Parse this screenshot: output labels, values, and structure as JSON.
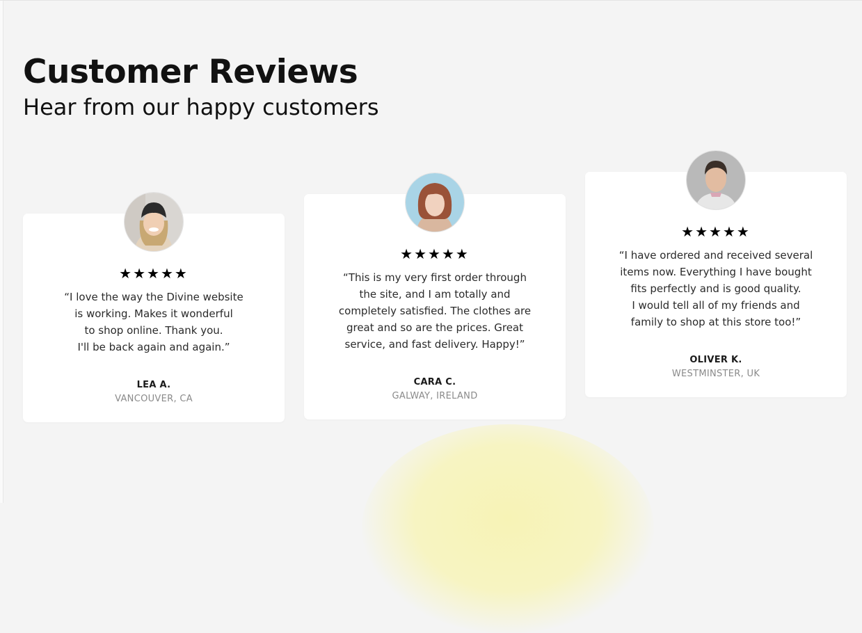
{
  "header": {
    "title": "Customer Reviews",
    "subtitle": "Hear from our happy customers"
  },
  "reviews": [
    {
      "stars": "★★★★★",
      "rating": 5,
      "quote": "“I love the way the Divine website\nis working. Makes it wonderful\nto shop online. Thank you.\nI'll be back again and again.”",
      "name": "LEA A.",
      "location": "VANCOUVER, CA"
    },
    {
      "stars": "★★★★★",
      "rating": 5,
      "quote": "“This is my very first order through\nthe site, and I am totally and\ncompletely satisfied. The clothes are\ngreat and so are the prices. Great\nservice, and fast delivery. Happy!”",
      "name": "CARA C.",
      "location": "GALWAY, IRELAND"
    },
    {
      "stars": "★★★★★",
      "rating": 5,
      "quote": "“I have ordered and received several\nitems now. Everything I have bought\nfits perfectly and is good quality.\nI would tell all of my friends and\nfamily to shop at this store too!”",
      "name": "OLIVER K.",
      "location": "WESTMINSTER, UK"
    }
  ],
  "colors": {
    "background": "#f4f4f4",
    "card": "#ffffff",
    "text": "#111111",
    "muted": "#8a8a8a",
    "accent_blob": "#f7f3b6"
  }
}
